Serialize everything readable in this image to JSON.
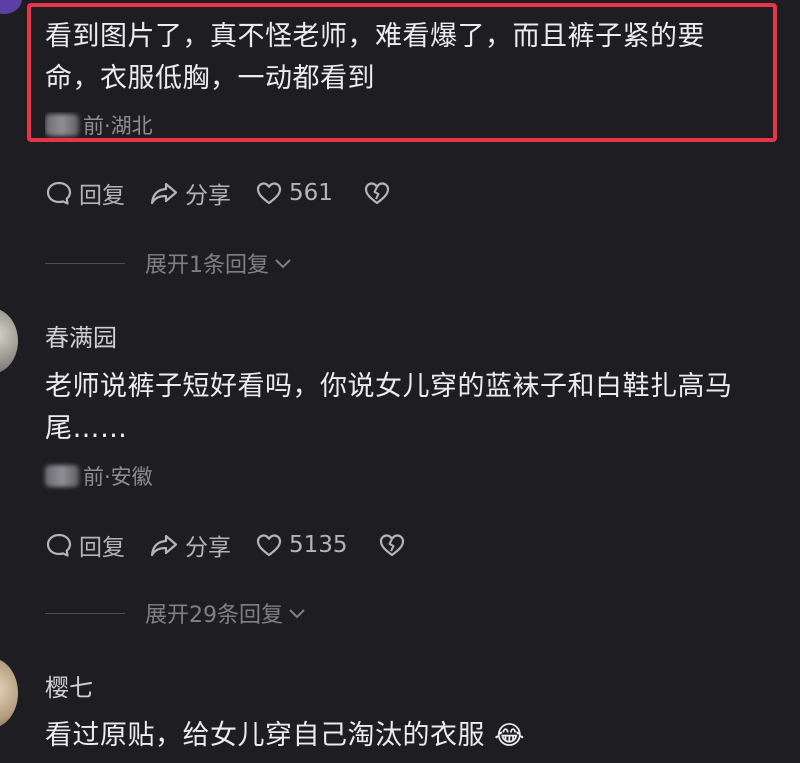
{
  "comments": [
    {
      "text_line1": "看到图片了，真不怪老师，难看爆了，而且裤子紧的要",
      "text_line2": "命，衣服低胸，一动都看到",
      "meta_suffix": "前·湖北",
      "reply_label": "回复",
      "share_label": "分享",
      "likes": "561",
      "expand_label": "展开1条回复"
    },
    {
      "username": "春满园",
      "text_line1": "老师说裤子短好看吗，你说女儿穿的蓝袜子和白鞋扎高马",
      "text_line2": "尾……",
      "meta_suffix": "前·安徽",
      "reply_label": "回复",
      "share_label": "分享",
      "likes": "5135",
      "expand_label": "展开29条回复"
    },
    {
      "username": "樱七",
      "text_line1": "看过原贴，给女儿穿自己淘汰的衣服",
      "emoji": "😂"
    }
  ],
  "colors": {
    "background": "#1e1e22",
    "highlight": "#e8344a",
    "text": "#ececef",
    "muted": "#8d8d93"
  }
}
